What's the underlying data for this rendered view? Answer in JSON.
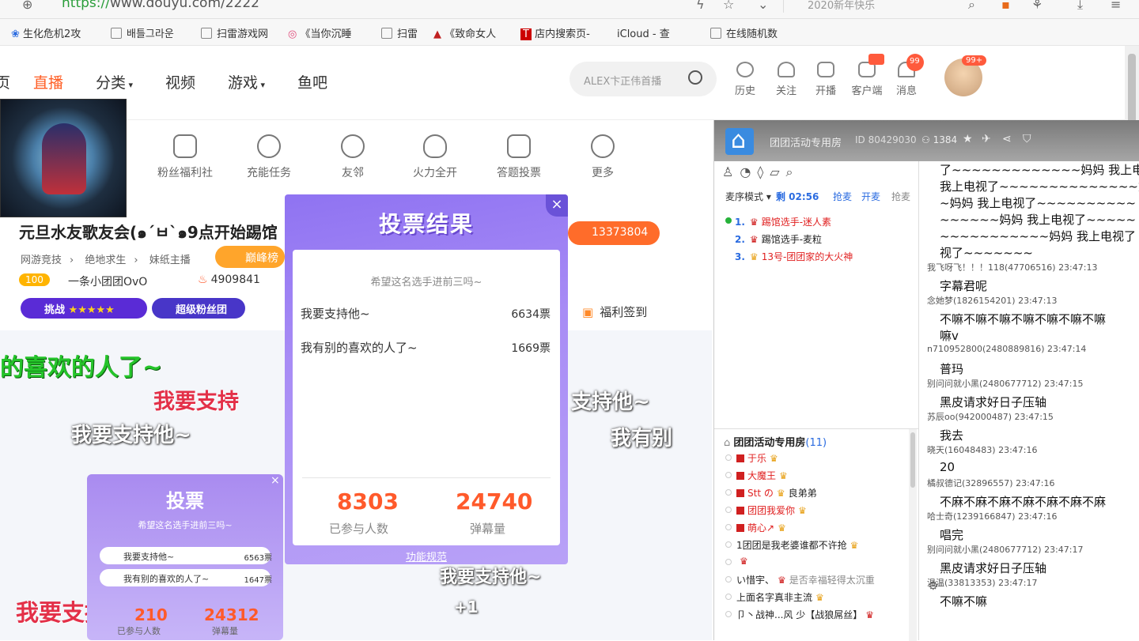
{
  "browser": {
    "url_prefix": "https://",
    "url": "www.douyu.com/2222",
    "search_placeholder": "2020新年快乐",
    "bookmarks": [
      "生化危机2攻",
      "배틀그라운",
      "扫雷游戏网",
      "《当你沉睡",
      "扫雷",
      "《致命女人",
      "店内搜索页-",
      "iCloud - 查",
      "在线随机数"
    ]
  },
  "nav": {
    "items": [
      "页",
      "直播",
      "分类",
      "视频",
      "游戏",
      "鱼吧"
    ],
    "search_placeholder": "ALEX卞正伟首播",
    "icons": [
      "历史",
      "关注",
      "开播",
      "客户端",
      "消息"
    ],
    "msg_badge": "99",
    "avatar_badge": "99+"
  },
  "room": {
    "functions": [
      "粉丝福利社",
      "充能任务",
      "友邻",
      "火力全开",
      "答题投票",
      "更多"
    ],
    "title": "元旦水友歌友会(๑´ㅂ`๑9点开始踢馆",
    "crumbs": [
      "网游竞技",
      "绝地求生",
      "妹纸主播"
    ],
    "tag": "巅峰榜",
    "level": "100",
    "owner": "一条小团团OvO",
    "heat": "4909841",
    "challenge": "挑战",
    "fans": "超级粉丝团",
    "rank_value": "13373804",
    "sign": "福利签到"
  },
  "danmaku": [
    {
      "text": "的喜欢的人了~",
      "style": "green"
    },
    {
      "text": "我要支持",
      "style": "red"
    },
    {
      "text": "我要支持他~",
      "style": "white"
    },
    {
      "text": "支持他~",
      "style": "white"
    },
    {
      "text": "我有别",
      "style": "white"
    },
    {
      "text": "我要支持他~",
      "style": "red"
    },
    {
      "text": "我要支持他~",
      "style": "white"
    },
    {
      "text": "+1",
      "style": "white"
    }
  ],
  "mini_vote": {
    "title": "投票",
    "subtitle": "希望这名选手进前三吗~",
    "opt1": "我要支持他~",
    "opt1_votes": "6563票",
    "opt2": "我有别的喜欢的人了~",
    "opt2_votes": "1647票",
    "n1": "210",
    "n1_label": "已参与人数",
    "n2": "24312",
    "n2_label": "弹幕量"
  },
  "vote_modal": {
    "title": "投票结果",
    "close": "×",
    "question": "希望这名选手进前三吗~",
    "options": [
      {
        "label": "我要支持他~",
        "votes": "6634票"
      },
      {
        "label": "我有别的喜欢的人了~",
        "votes": "1669票"
      }
    ],
    "participants": "8303",
    "participants_label": "已参与人数",
    "danmaku_count": "24740",
    "danmaku_label": "弹幕量",
    "rules": "功能规范"
  },
  "panel": {
    "name": "团团活动专用房",
    "room_id": "ID 80429030",
    "users": "1384",
    "mode": "麦序模式",
    "timer": "剩 02:56",
    "mode_buttons": [
      "抢麦",
      "开麦",
      "抢麦"
    ],
    "queue": [
      {
        "n": "1.",
        "name": "踢馆选手-迷人素"
      },
      {
        "n": "2.",
        "name": "踢馆选手-麦粒"
      },
      {
        "n": "3.",
        "name": "13号-团团家的大火神"
      }
    ],
    "mic_title": "团团活动专用房",
    "mic_count": "(11)",
    "members": [
      "于乐",
      "大魔王",
      "Stt の",
      "团团我爱你",
      "萌心↗",
      "1团团是我老婆谁都不许抢",
      "",
      "い惜宇、",
      "上面名字真非主流",
      "卩丶战神...风  少【战狼屌丝】"
    ],
    "member_extra": [
      "",
      "",
      "良弟弟",
      "",
      "",
      "",
      "",
      "是否幸福轻得太沉重",
      "",
      ""
    ],
    "chat": [
      {
        "type": "line",
        "text": "了~~~~~~~~~~~~~妈妈  我上电"
      },
      {
        "type": "line",
        "text": "我上电视了~~~~~~~~~~~~~~妈"
      },
      {
        "type": "line",
        "text": "~妈妈  我上电视了~~~~~~~~~~"
      },
      {
        "type": "line",
        "text": "~~~~~~妈妈  我上电视了~~~~~"
      },
      {
        "type": "line",
        "text": "~~~~~~~~~~~妈妈  我上电视了"
      },
      {
        "type": "line",
        "text": "视了~~~~~~~"
      },
      {
        "type": "meta",
        "text": "我飞呀飞！！！118(47706516) 23:47:13"
      },
      {
        "type": "line",
        "text": "字幕君呢"
      },
      {
        "type": "meta",
        "text": "念她梦(1826154201) 23:47:13"
      },
      {
        "type": "line",
        "text": "不嘛不嘛不嘛不嘛不嘛不嘛不嘛"
      },
      {
        "type": "line",
        "text": "嘛v"
      },
      {
        "type": "meta",
        "text": "n710952800(2480889816) 23:47:14"
      },
      {
        "type": "line",
        "text": "普玛"
      },
      {
        "type": "meta",
        "text": "别问问就小黑(2480677712) 23:47:15"
      },
      {
        "type": "line",
        "text": "黑皮请求好日子压轴"
      },
      {
        "type": "meta",
        "text": "苏辰oo(942000487) 23:47:15"
      },
      {
        "type": "line",
        "text": "我去"
      },
      {
        "type": "meta",
        "text": "晓天(16048483) 23:47:16"
      },
      {
        "type": "line",
        "text": "20"
      },
      {
        "type": "meta",
        "text": "橘叔德记(32896557) 23:47:16"
      },
      {
        "type": "line",
        "text": "不麻不麻不麻不麻不麻不麻不麻"
      },
      {
        "type": "meta",
        "text": "哈士奇(1239166847) 23:47:16"
      },
      {
        "type": "line",
        "text": "唱完"
      },
      {
        "type": "meta",
        "text": "别问问就小黑(2480677712) 23:47:17"
      },
      {
        "type": "line",
        "text": "黑皮请求好日子压轴"
      },
      {
        "type": "meta",
        "text": "温温(33813353) 23:47:17"
      },
      {
        "type": "line",
        "text": "不嘛不嘛"
      }
    ]
  }
}
